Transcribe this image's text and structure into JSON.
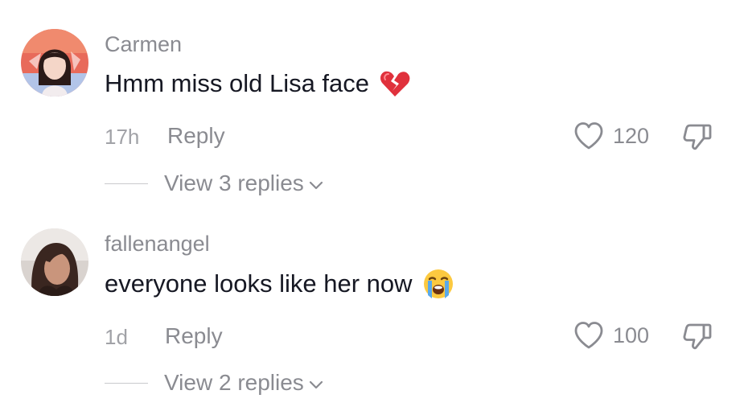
{
  "comments": [
    {
      "username": "Carmen",
      "text": "Hmm miss old Lisa face",
      "emoji": "broken-heart-emoji",
      "time": "17h",
      "reply_label": "Reply",
      "likes": "120",
      "view_replies": "View 3 replies"
    },
    {
      "username": "fallenangel",
      "text": "everyone looks like her now",
      "emoji": "loudly-crying-face-emoji",
      "time": "1d",
      "reply_label": "Reply",
      "likes": "100",
      "view_replies": "View 2 replies"
    }
  ],
  "colors": {
    "text": "#161823",
    "secondary": "#8a8b91",
    "muted": "#a1a2a7"
  }
}
